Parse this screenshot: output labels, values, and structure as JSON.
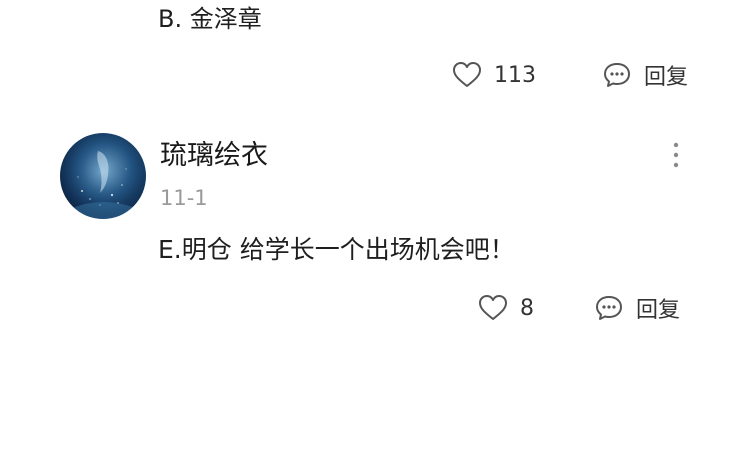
{
  "previous_comment": {
    "text": "B. 金泽章",
    "likes": "113",
    "reply_label": "回复"
  },
  "comment": {
    "username": "琉璃绘衣",
    "date": "11-1",
    "text": "E.明仓 给学长一个出场机会吧！",
    "likes": "8",
    "reply_label": "回复"
  },
  "icons": {
    "like": "heart-outline-icon",
    "reply": "chat-bubble-icon",
    "more": "more-vertical-icon"
  },
  "colors": {
    "text": "#1a1a1a",
    "secondary": "#9a9a9a",
    "icon_stroke": "#555555"
  }
}
